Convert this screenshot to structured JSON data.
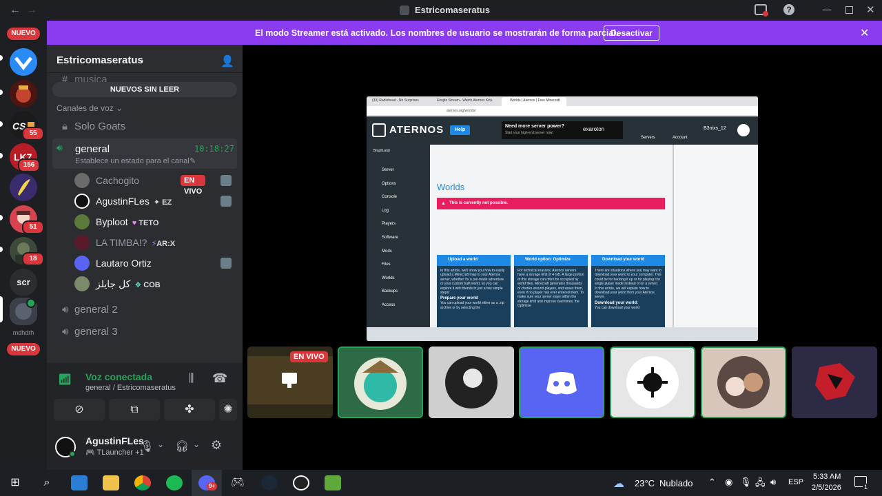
{
  "window": {
    "title": "Estricomaseratus",
    "back_icon": "←",
    "forward_icon": "→"
  },
  "banner": {
    "message": "El modo Streamer está activado. Los nombres de usuario se mostrarán de forma parcial.",
    "button": "Desactivar",
    "close": "✕"
  },
  "rail": {
    "top_badge": "NUEVO",
    "bottom_badge": "NUEVO",
    "guilds": [
      {
        "name": "valorant",
        "badge": ""
      },
      {
        "name": "game-server",
        "badge": ""
      },
      {
        "name": "cs2",
        "badge": "55"
      },
      {
        "name": "lk7",
        "badge": "156"
      },
      {
        "name": "banana",
        "badge": ""
      },
      {
        "name": "anime",
        "badge": "51"
      },
      {
        "name": "soldier",
        "badge": "18"
      },
      {
        "name": "scr",
        "label": "scr",
        "badge": ""
      },
      {
        "name": "estrico",
        "badge": ""
      },
      {
        "name": "mdhdrh",
        "label": "mdhdrh",
        "badge": ""
      }
    ]
  },
  "sidebar": {
    "server_name": "Estricomaseratus",
    "partial_channel": "musica",
    "unread_button": "NUEVOS SIN LEER",
    "voice_category": "Canales de voz",
    "channels": {
      "solo_goats": "Solo Goats",
      "general": "general",
      "general_timer": "10:18:27",
      "general_status": "Establece un estado para el canal",
      "general2": "general 2",
      "general3": "general 3"
    },
    "users": [
      {
        "name": "Cachogito",
        "live": "EN VIVO",
        "tag": ""
      },
      {
        "name": "AgustinFLes",
        "live": "",
        "tag": "EZ"
      },
      {
        "name": "Byploot",
        "live": "",
        "tag": "TETO"
      },
      {
        "name": "LA TIMBA!?",
        "live": "",
        "tag": "AR:X"
      },
      {
        "name": "Lautaro Ortiz",
        "live": "",
        "tag": ""
      },
      {
        "name": "كل جايلز",
        "live": "",
        "tag": "COB"
      }
    ],
    "voice": {
      "status": "Voz conectada",
      "location": "general / Estricomaseratus"
    },
    "user": {
      "name": "AgustinFLes",
      "activity": "TLauncher +1"
    }
  },
  "stream": {
    "tabs": [
      "(33) Radiohead - No Surprises",
      "Elrojito Stream - Watch Aternos Kick",
      "Worlds | Aternos | Free Minecraft"
    ],
    "url": "aternos.org/worlds/",
    "brand": "ATERNOS",
    "help": "Help",
    "ad_title": "Need more server power?",
    "ad_sub": "Start your high-end server now!",
    "ad_brand": "exaroton",
    "servers": "Servers",
    "account": "Account",
    "username": "B3nixs_12",
    "server_label": "BrazilLand",
    "menu": [
      "Server",
      "Options",
      "Console",
      "Log",
      "Players",
      "Software",
      "Mods",
      "Files",
      "Worlds",
      "Backups",
      "Access"
    ],
    "page_title": "Worlds",
    "alert": "This is currently not possible.",
    "cards": [
      {
        "title": "Upload a world",
        "text": "In this article, we'll show you how to easily upload a Minecraft map to your Aternos server, whether it's a pre-made adventure or your custom built world, so you can explore it with friends in just a few simple steps!",
        "sub": "Prepare your world",
        "sub_text": "You can upload your world either as a .zip archive or by selecting the"
      },
      {
        "title": "World option: Optimize",
        "text": "For technical reasons, Aternos servers have a storage limit of 4 GB. A large portion of this storage can often be occupied by world files. Minecraft generates thousands of chunks around players, and saves them, even if no player has ever entered them. To make sure your server stays within the storage limit and improve load times, the Optimize",
        "sub": "",
        "sub_text": ""
      },
      {
        "title": "Download your world",
        "text": "There are situations where you may want to download your world to your computer. This could be for backing it up or for playing it in single player mode instead of on a server. In this article, we will explain how to download your world from your Aternos server.",
        "sub": "Download your world:",
        "sub_text": "You can download your world"
      }
    ]
  },
  "tiles": {
    "live_label": "EN VIVO"
  },
  "taskbar": {
    "weather_temp": "23°C",
    "weather_text": "Nublado",
    "lang": "ESP",
    "time": "5:33 AM",
    "date": "2/5/2026",
    "discord_badge": "9+",
    "notif_count": "1"
  },
  "colors": {
    "accent_purple": "#8b3cf1",
    "live_red": "#da373c",
    "voice_green": "#23a55a",
    "blurple": "#5865f2"
  }
}
